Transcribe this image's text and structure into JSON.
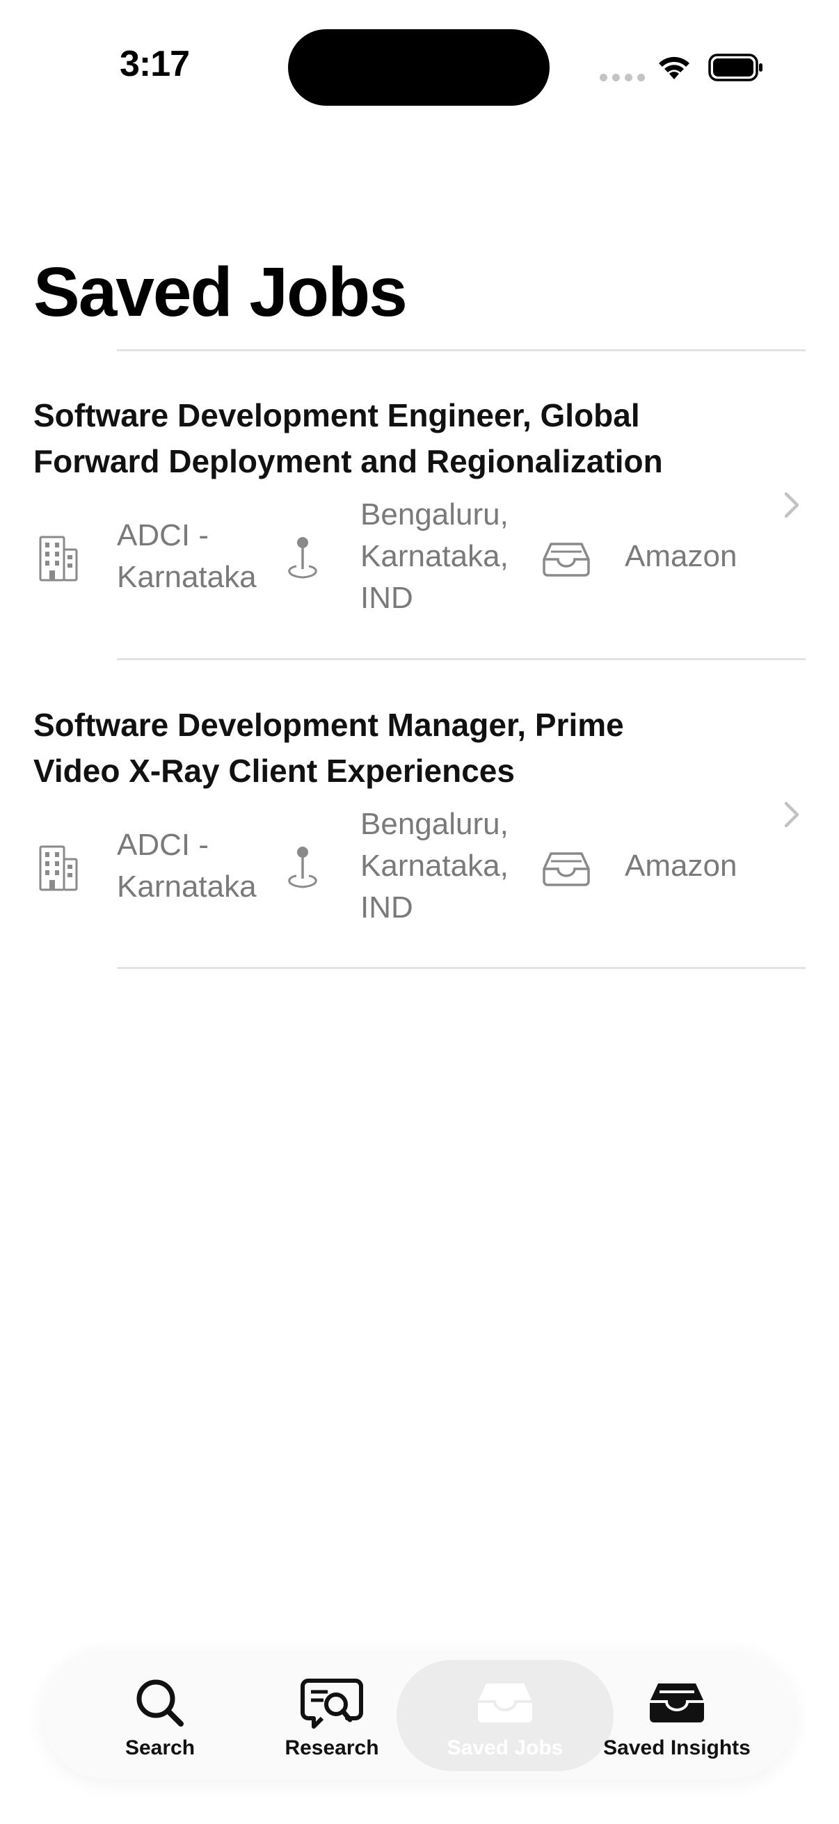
{
  "status_bar": {
    "time": "3:17"
  },
  "page": {
    "title": "Saved Jobs"
  },
  "jobs": [
    {
      "title_line1": "Software Development Engineer, Global",
      "title_line2": "Forward Deployment and Regionalization",
      "office_line1": "ADCI -",
      "office_line2": "Karnataka",
      "location_line1": "Bengaluru,",
      "location_line2": "Karnataka,",
      "location_line3": "IND",
      "company": "Amazon",
      "icons": {
        "office": "building-icon",
        "location": "map-pin-icon",
        "company": "tray-icon",
        "chevron": "chevron-right-icon"
      }
    },
    {
      "title_line1": "Software Development Manager, Prime",
      "title_line2": "Video X-Ray Client Experiences",
      "office_line1": "ADCI -",
      "office_line2": "Karnataka",
      "location_line1": "Bengaluru,",
      "location_line2": "Karnataka,",
      "location_line3": "IND",
      "company": "Amazon",
      "icons": {
        "office": "building-icon",
        "location": "map-pin-icon",
        "company": "tray-icon",
        "chevron": "chevron-right-icon"
      }
    }
  ],
  "tabbar": {
    "selected": "Saved Jobs",
    "tabs": [
      {
        "label": "Search",
        "icon": "magnifying-glass-icon"
      },
      {
        "label": "Research",
        "icon": "text-magnifier-bubble-icon"
      },
      {
        "label": "Saved Jobs",
        "icon": "tray-icon"
      },
      {
        "label": "Saved Insights",
        "icon": "tray-full-icon"
      }
    ]
  },
  "colors": {
    "text_primary": "#111111",
    "text_secondary": "#7a7a7a",
    "divider": "#e3e3e3",
    "selected_tab_bg": "#ececec"
  }
}
